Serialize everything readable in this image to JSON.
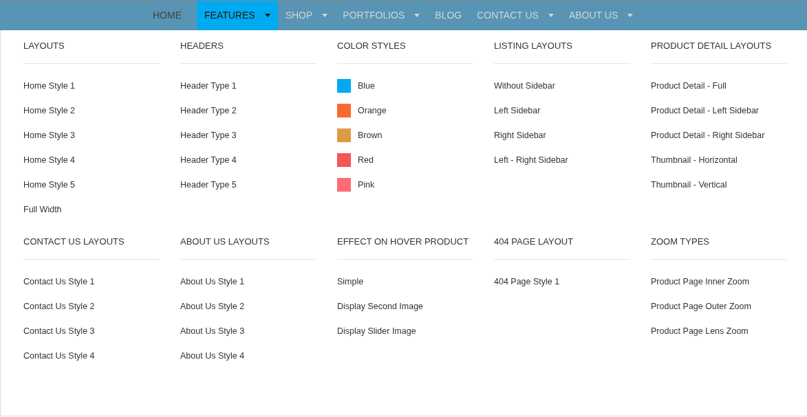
{
  "nav": [
    {
      "label": "HOME",
      "selected": false,
      "dropdown": false
    },
    {
      "label": "FEATURES",
      "selected": true,
      "dropdown": true
    },
    {
      "label": "SHOP",
      "selected": false,
      "dropdown": true
    },
    {
      "label": "PORTFOLIOS",
      "selected": false,
      "dropdown": true
    },
    {
      "label": "BLOG",
      "selected": false,
      "dropdown": false
    },
    {
      "label": "CONTACT US",
      "selected": false,
      "dropdown": true
    },
    {
      "label": "ABOUT US",
      "selected": false,
      "dropdown": true
    }
  ],
  "mega_menu": [
    {
      "title": "LAYOUTS",
      "items": [
        {
          "label": "Home Style 1"
        },
        {
          "label": "Home Style 2"
        },
        {
          "label": "Home Style 3"
        },
        {
          "label": "Home Style 4"
        },
        {
          "label": "Home Style 5"
        },
        {
          "label": "Full Width"
        }
      ]
    },
    {
      "title": "HEADERS",
      "items": [
        {
          "label": "Header Type 1"
        },
        {
          "label": "Header Type 2"
        },
        {
          "label": "Header Type 3"
        },
        {
          "label": "Header Type 4"
        },
        {
          "label": "Header Type 5"
        }
      ]
    },
    {
      "title": "COLOR STYLES",
      "items": [
        {
          "label": "Blue",
          "color": "#00aaf0"
        },
        {
          "label": "Orange",
          "color": "#f86a2e"
        },
        {
          "label": "Brown",
          "color": "#dd9b48"
        },
        {
          "label": "Red",
          "color": "#f45757"
        },
        {
          "label": "Pink",
          "color": "#fa6d72"
        }
      ]
    },
    {
      "title": "LISTING LAYOUTS",
      "items": [
        {
          "label": "Without Sidebar"
        },
        {
          "label": "Left Sidebar"
        },
        {
          "label": "Right Sidebar"
        },
        {
          "label": "Left - Right Sidebar"
        }
      ]
    },
    {
      "title": "PRODUCT DETAIL LAYOUTS",
      "items": [
        {
          "label": "Product Detail - Full"
        },
        {
          "label": "Product Detail - Left Sidebar"
        },
        {
          "label": "Product Detail - Right Sidebar"
        },
        {
          "label": "Thumbnail - Horizontal"
        },
        {
          "label": "Thumbnail - Vertical"
        }
      ]
    },
    {
      "title": "CONTACT US LAYOUTS",
      "items": [
        {
          "label": "Contact Us Style 1"
        },
        {
          "label": "Contact Us Style 2"
        },
        {
          "label": "Contact Us Style 3"
        },
        {
          "label": "Contact Us Style 4"
        }
      ]
    },
    {
      "title": "ABOUT US LAYOUTS",
      "items": [
        {
          "label": "About Us Style 1"
        },
        {
          "label": "About Us Style 2"
        },
        {
          "label": "About Us Style 3"
        },
        {
          "label": "About Us Style 4"
        }
      ]
    },
    {
      "title": "EFFECT ON HOVER PRODUCT",
      "items": [
        {
          "label": "Simple"
        },
        {
          "label": "Display Second Image"
        },
        {
          "label": "Display Slider Image"
        }
      ]
    },
    {
      "title": "404 PAGE LAYOUT",
      "items": [
        {
          "label": "404 Page Style 1"
        }
      ]
    },
    {
      "title": "ZOOM TYPES",
      "items": [
        {
          "label": "Product Page Inner Zoom"
        },
        {
          "label": "Product Page Outer Zoom"
        },
        {
          "label": "Product Page Lens Zoom"
        }
      ]
    }
  ]
}
